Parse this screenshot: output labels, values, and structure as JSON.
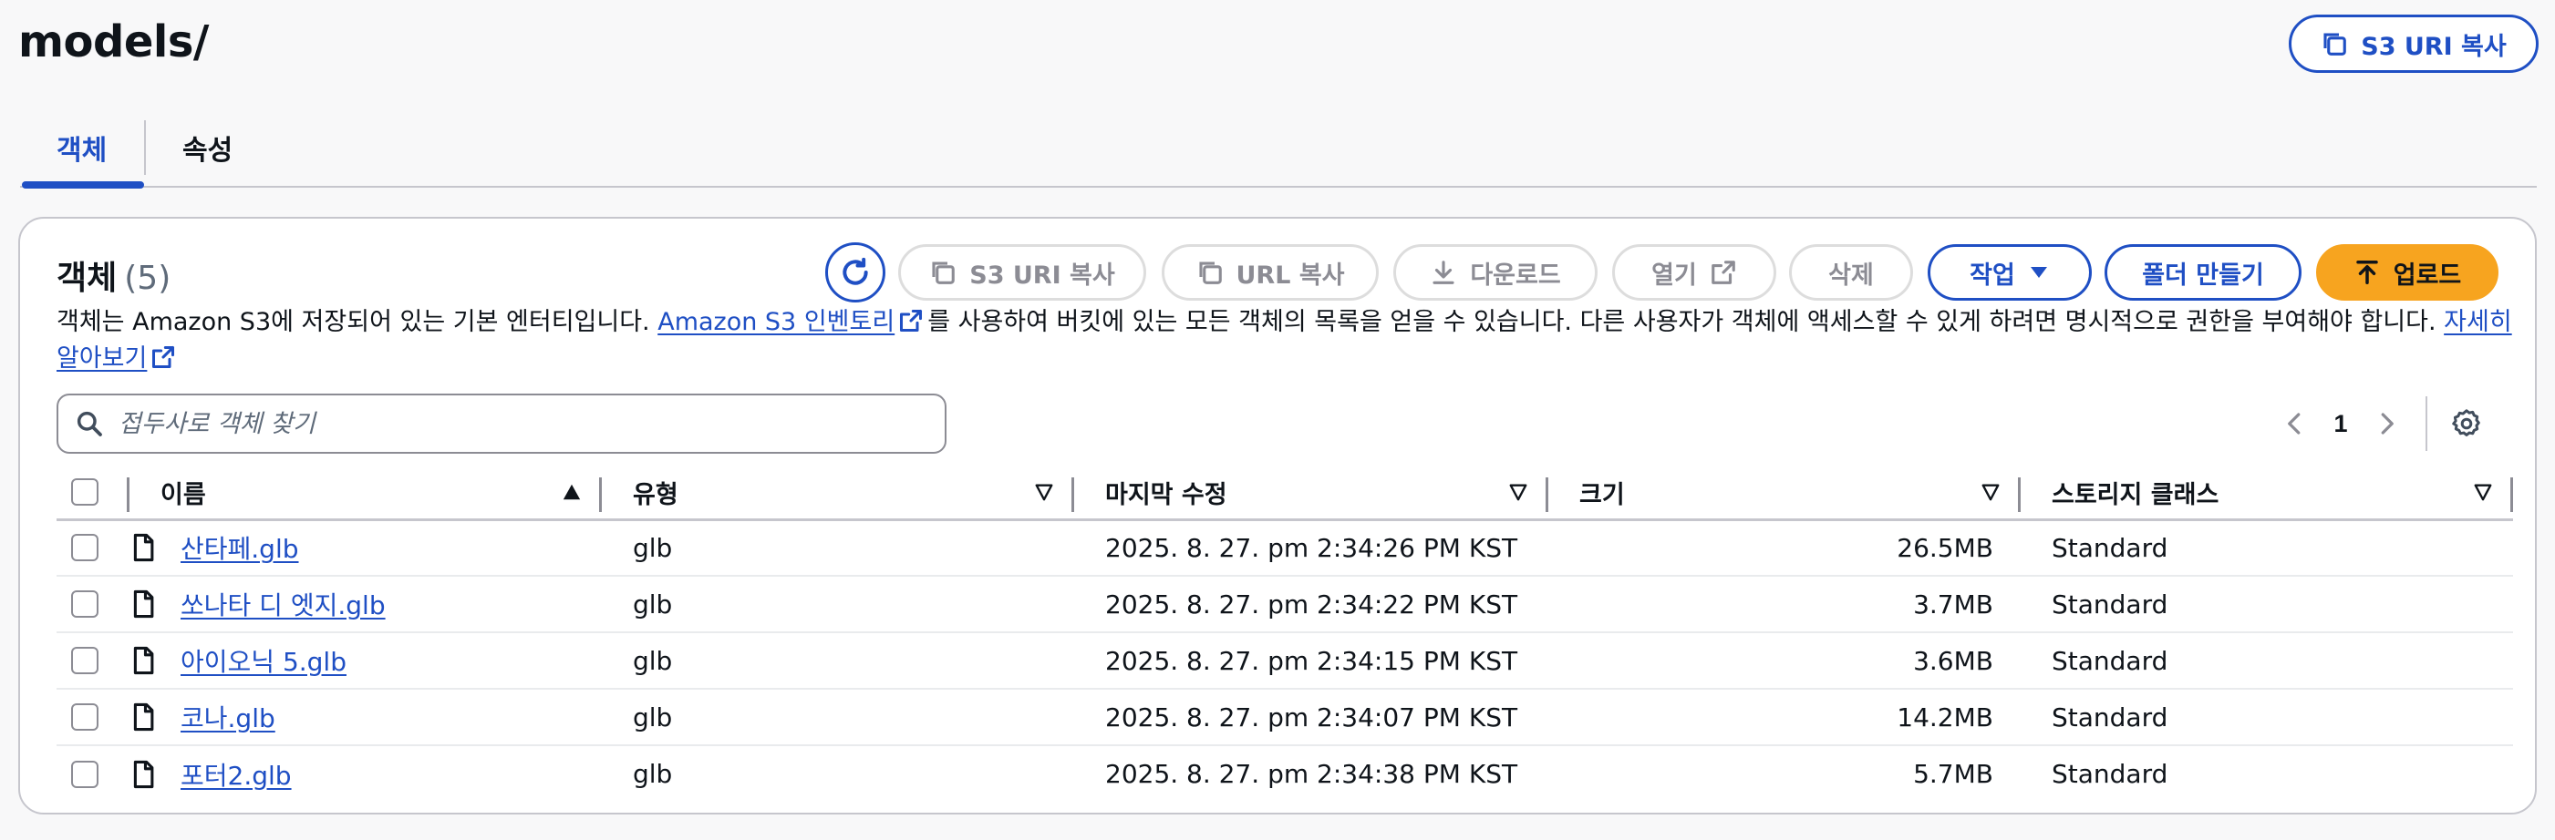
{
  "header": {
    "title": "models/",
    "copy_uri_label": "S3 URI 복사"
  },
  "tabs": [
    {
      "label": "객체",
      "active": true
    },
    {
      "label": "속성",
      "active": false
    }
  ],
  "objects_panel": {
    "title": "객체",
    "count": "(5)",
    "toolbar": {
      "copy_s3_uri": "S3 URI 복사",
      "copy_url": "URL 복사",
      "download": "다운로드",
      "open": "열기",
      "delete": "삭제",
      "actions": "작업",
      "create_folder": "폴더 만들기",
      "upload": "업로드"
    },
    "description": {
      "before_link": "객체는 Amazon S3에 저장되어 있는 기본 엔터티입니다. ",
      "inventory_link": "Amazon S3 인벤토리",
      "after_link": "를 사용하여 버킷에 있는 모든 객체의 목록을 얻을 수 있습니다. 다른 사용자가 객체에 액세스할 수 있게 하려면 명시적으로 권한을 부여해야 합니다. ",
      "learn_more": "자세히 알아보기"
    },
    "search": {
      "placeholder": "접두사로 객체 찾기",
      "value": ""
    },
    "pagination": {
      "current_page": "1"
    },
    "columns": {
      "name": "이름",
      "type": "유형",
      "last_modified": "마지막 수정",
      "size": "크기",
      "storage_class": "스토리지 클래스"
    },
    "rows": [
      {
        "name": "산타페.glb",
        "type": "glb",
        "last_modified": "2025. 8. 27. pm 2:34:26 PM KST",
        "size": "26.5MB",
        "storage_class": "Standard"
      },
      {
        "name": "쏘나타 디 엣지.glb",
        "type": "glb",
        "last_modified": "2025. 8. 27. pm 2:34:22 PM KST",
        "size": "3.7MB",
        "storage_class": "Standard"
      },
      {
        "name": "아이오닉 5.glb",
        "type": "glb",
        "last_modified": "2025. 8. 27. pm 2:34:15 PM KST",
        "size": "3.6MB",
        "storage_class": "Standard"
      },
      {
        "name": "코나.glb",
        "type": "glb",
        "last_modified": "2025. 8. 27. pm 2:34:07 PM KST",
        "size": "14.2MB",
        "storage_class": "Standard"
      },
      {
        "name": "포터2.glb",
        "type": "glb",
        "last_modified": "2025. 8. 27. pm 2:34:38 PM KST",
        "size": "5.7MB",
        "storage_class": "Standard"
      }
    ]
  },
  "icons": [
    "copy-icon",
    "refresh-icon",
    "download-icon",
    "external-link-icon",
    "caret-down-icon",
    "upload-icon",
    "search-icon",
    "chevron-left-icon",
    "chevron-right-icon",
    "gear-icon",
    "sort-ascending-icon",
    "sort-descending-icon",
    "file-icon"
  ],
  "colors": {
    "link": "#1f4fc4",
    "primary": "#f7a41f",
    "border": "#c6c6cd"
  }
}
